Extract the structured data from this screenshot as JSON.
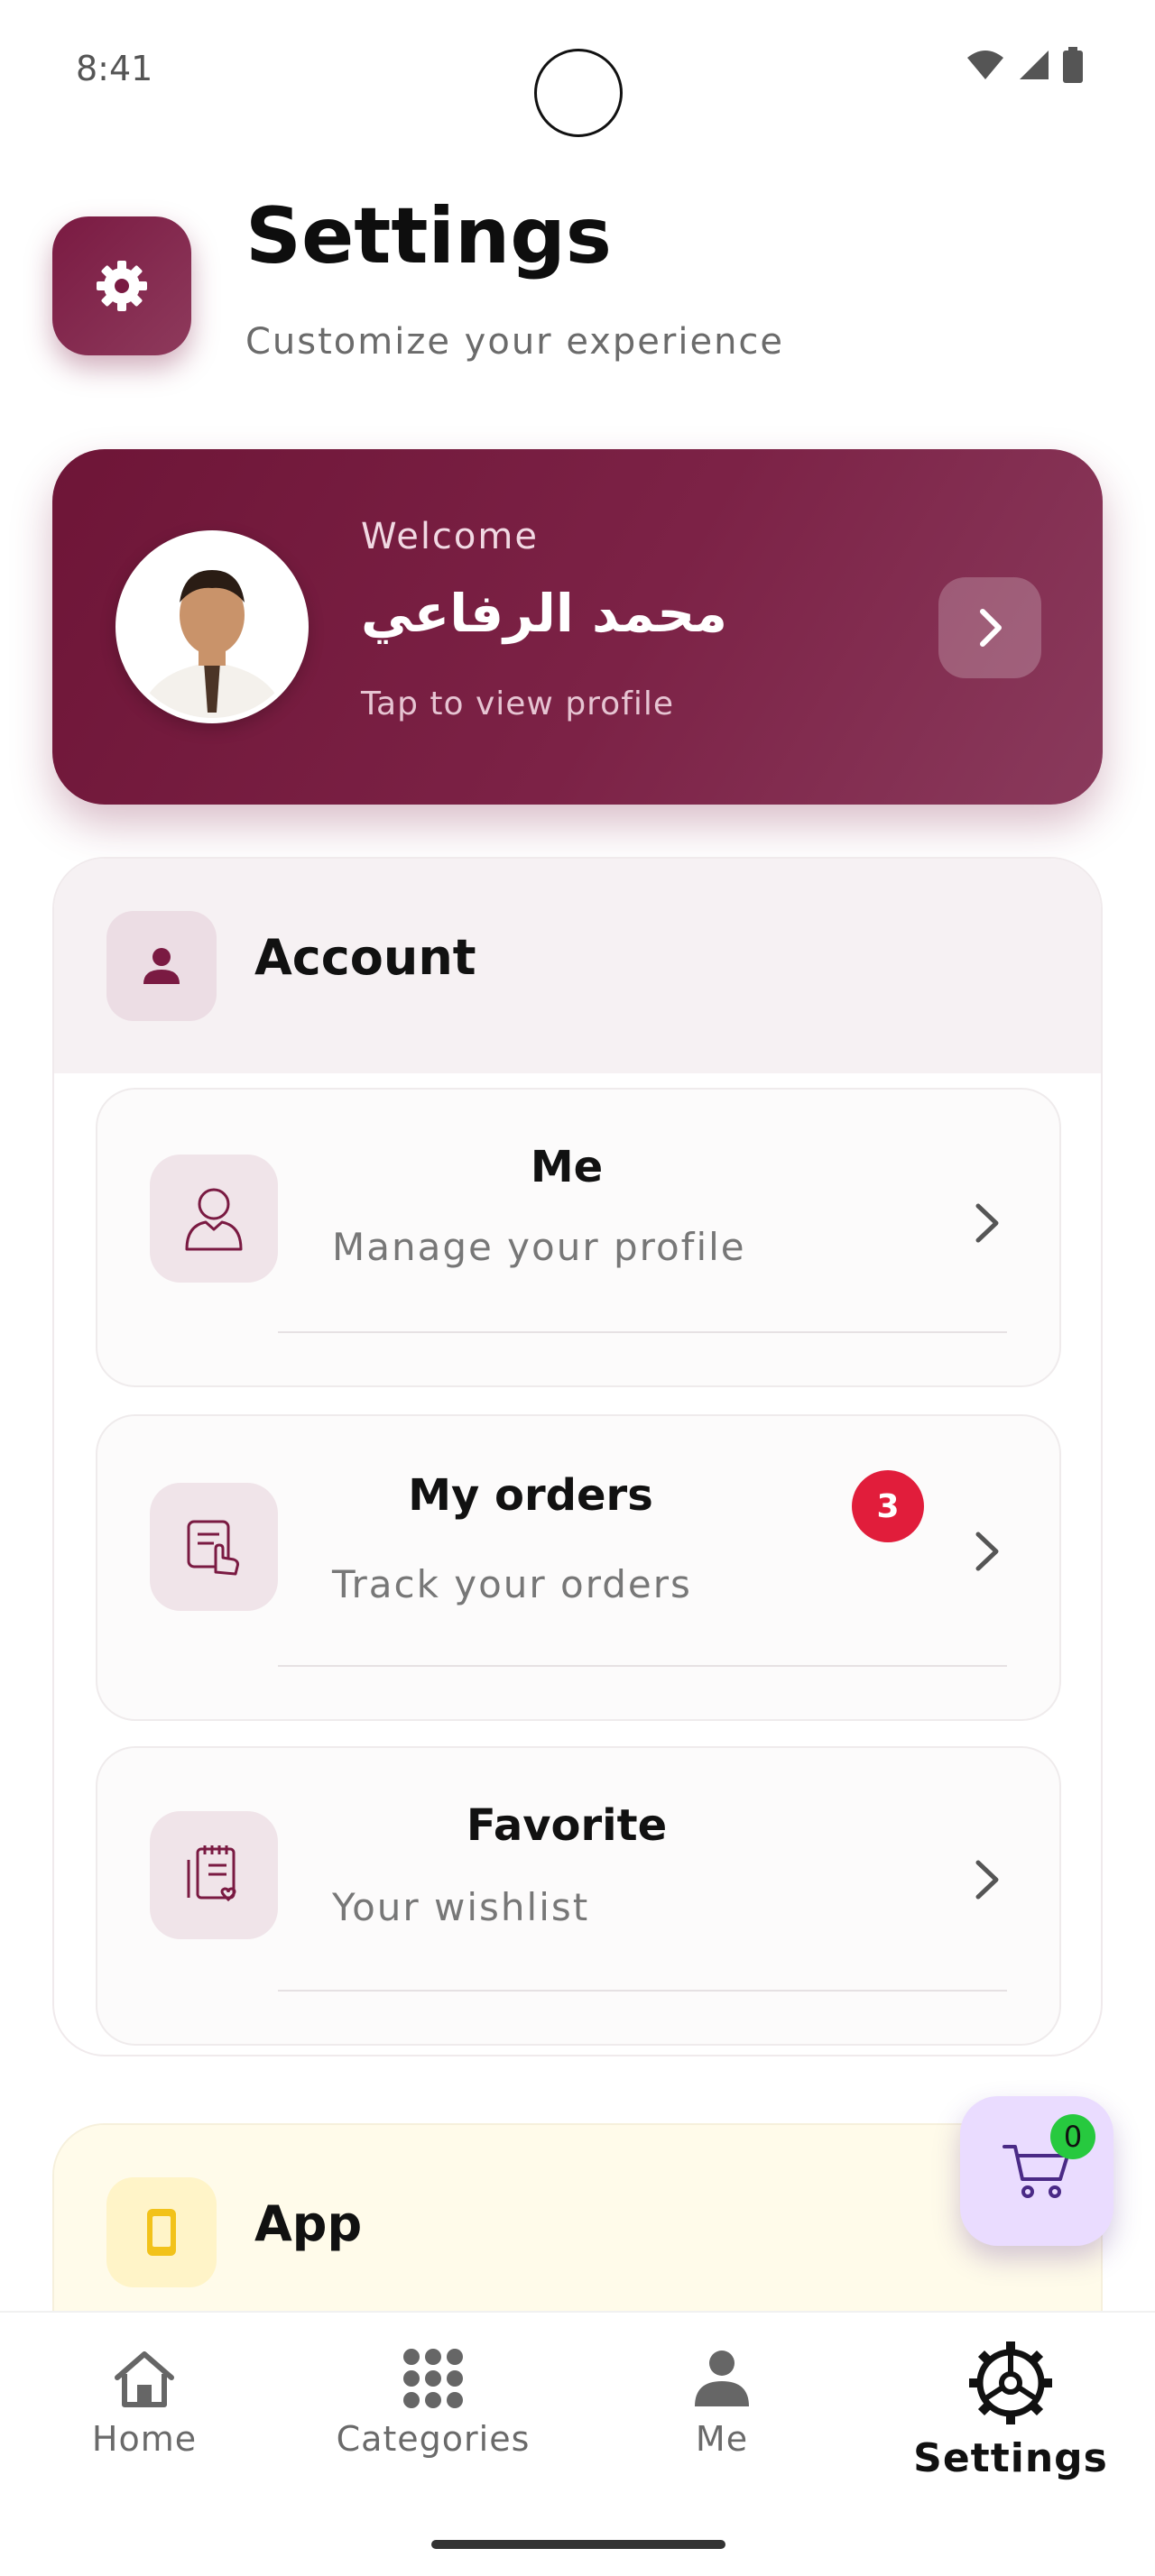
{
  "status_bar": {
    "time": "8:41"
  },
  "header": {
    "title": "Settings",
    "subtitle": "Customize your experience",
    "icon": "gear-icon"
  },
  "profile": {
    "welcome": "Welcome",
    "name": "محمد الرفاعي",
    "hint": "Tap to view profile"
  },
  "account": {
    "title": "Account",
    "items": [
      {
        "title": "Me",
        "subtitle": "Manage your profile",
        "icon": "user-outline-icon"
      },
      {
        "title": "My orders",
        "subtitle": "Track your orders",
        "icon": "order-hand-icon",
        "badge": "3"
      },
      {
        "title": "Favorite",
        "subtitle": "Your wishlist",
        "icon": "wishlist-icon"
      }
    ]
  },
  "app_section": {
    "title": "App",
    "icon": "phone-icon"
  },
  "cart": {
    "count": "0"
  },
  "nav": {
    "items": [
      {
        "label": "Home",
        "icon": "home-icon"
      },
      {
        "label": "Categories",
        "icon": "grid-dots-icon"
      },
      {
        "label": "Me",
        "icon": "person-icon"
      },
      {
        "label": "Settings",
        "icon": "settings-wheel-icon",
        "active": true
      }
    ]
  },
  "colors": {
    "primary": "#7a1a42",
    "badge": "#e11d3b",
    "cart_bg": "#eadcff",
    "app_bg": "#fffcee"
  }
}
